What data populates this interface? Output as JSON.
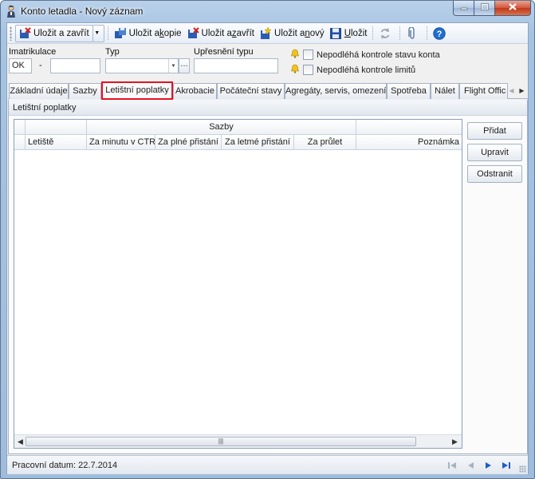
{
  "window": {
    "title": "Konto letadla  - Nový záznam"
  },
  "toolbar": {
    "save_close_dropdown": "Uložit a zavřít",
    "save_copy_pre": "Uložit a ",
    "save_copy_key": "k",
    "save_copy_post": "opie",
    "save_close_pre": "Uložit a ",
    "save_close_key": "z",
    "save_close_post": "avřít",
    "save_new_pre": "Uložit a ",
    "save_new_key": "n",
    "save_new_post": "ový",
    "save_key": "U",
    "save_post": "ložit"
  },
  "form": {
    "imatrikulace_label": "Imatrikulace",
    "imatrikulace_prefix": "OK",
    "imatrikulace_dash": "-",
    "imatrikulace_value": "",
    "typ_label": "Typ",
    "typ_value": "",
    "upresneni_label": "Upřesnění typu",
    "upresneni_value": "",
    "chk_konto_label": "Nepodléhá kontrole stavu konta",
    "chk_limity_label": "Nepodléhá kontrole limitů"
  },
  "tabs": [
    {
      "label": "Základní údaje"
    },
    {
      "label": "Sazby"
    },
    {
      "label": "Letištní poplatky"
    },
    {
      "label": "Akrobacie"
    },
    {
      "label": "Počáteční stavy"
    },
    {
      "label": "Agregáty, servis, omezení"
    },
    {
      "label": "Spotřeba"
    },
    {
      "label": "Nálet"
    },
    {
      "label": "Flight Offic"
    }
  ],
  "tabpage": {
    "group_title": "Letištní poplatky"
  },
  "grid": {
    "band_sazby": "Sazby",
    "columns": {
      "letiste": "Letiště",
      "za_minutu": "Za minutu v CTR",
      "za_plne": "Za plné přistání",
      "za_letme": "Za letmé přistání",
      "za_prulet": "Za průlet",
      "poznamka": "Poznámka"
    }
  },
  "buttons": {
    "pridat": "Přidat",
    "upravit": "Upravit",
    "odstranit": "Odstranit"
  },
  "status": {
    "text": "Pracovní datum: 22.7.2014"
  },
  "colors": {
    "accent_blue": "#1f5fc4",
    "active_tab_outline": "#e81123",
    "close_button": "#c1381a"
  }
}
